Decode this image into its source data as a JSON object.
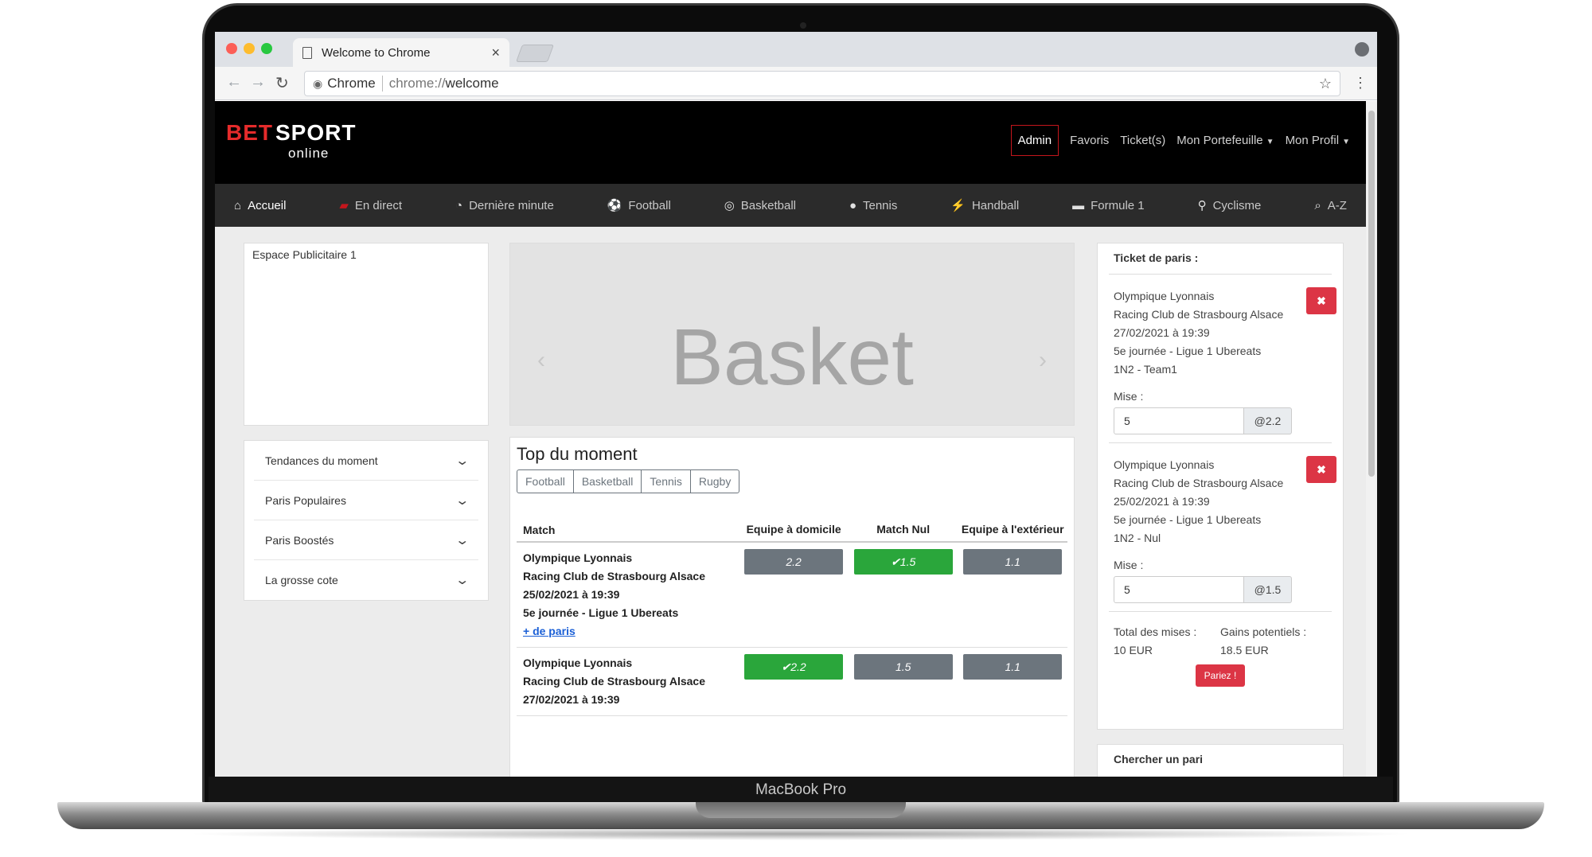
{
  "device": {
    "label": "MacBook Pro"
  },
  "browser": {
    "tab_title": "Welcome to Chrome",
    "close_glyph": "×",
    "omnibox": {
      "site_label": "Chrome",
      "url_scheme": "chrome://",
      "url_host": "welcome"
    }
  },
  "site": {
    "logo": {
      "bet": "BET",
      "sport": "SPORT",
      "online": "online"
    },
    "topnav": {
      "admin": "Admin",
      "favoris": "Favoris",
      "tickets": "Ticket(s)",
      "portefeuille": "Mon Portefeuille",
      "profil": "Mon Profil"
    },
    "sportnav": [
      {
        "label": "Accueil",
        "icon": "home-icon"
      },
      {
        "label": "En direct",
        "icon": "live-icon"
      },
      {
        "label": "Dernière minute",
        "icon": "stopwatch-icon"
      },
      {
        "label": "Football",
        "icon": "football-icon"
      },
      {
        "label": "Basketball",
        "icon": "basketball-icon"
      },
      {
        "label": "Tennis",
        "icon": "tennis-icon"
      },
      {
        "label": "Handball",
        "icon": "handball-icon"
      },
      {
        "label": "Formule 1",
        "icon": "f1-car-icon"
      },
      {
        "label": "Cyclisme",
        "icon": "bicycle-icon"
      },
      {
        "label": "A-Z",
        "icon": "search-icon"
      }
    ]
  },
  "sidebar": {
    "ad_label": "Espace Publicitaire 1",
    "accordion": [
      {
        "label": "Tendances du moment"
      },
      {
        "label": "Paris Populaires"
      },
      {
        "label": "Paris Boostés"
      },
      {
        "label": "La grosse cote"
      }
    ]
  },
  "carousel": {
    "slide_text": "Basket"
  },
  "top_moment": {
    "title": "Top du moment",
    "filters": [
      "Football",
      "Basketball",
      "Tennis",
      "Rugby"
    ],
    "headers": {
      "match": "Match",
      "home": "Equipe à domicile",
      "draw": "Match Nul",
      "away": "Equipe à l'extérieur"
    },
    "rows": [
      {
        "team1": "Olympique Lyonnais",
        "team2": "Racing Club de Strasbourg Alsace",
        "date": "25/02/2021 à 19:39",
        "league": "5e journée - Ligue 1 Ubereats",
        "more": "+ de paris",
        "odds": [
          "2.2",
          "1.5",
          "1.1"
        ],
        "selected": [
          false,
          true,
          false
        ]
      },
      {
        "team1": "Olympique Lyonnais",
        "team2": "Racing Club de Strasbourg Alsace",
        "date": "27/02/2021 à 19:39",
        "league": "",
        "more": "",
        "odds": [
          "2.2",
          "1.5",
          "1.1"
        ],
        "selected": [
          true,
          false,
          false
        ]
      }
    ]
  },
  "ticket": {
    "title": "Ticket de paris :",
    "mise_label": "Mise :",
    "bets": [
      {
        "team1": "Olympique Lyonnais",
        "team2": "Racing Club de Strasbourg Alsace",
        "date": "27/02/2021 à 19:39",
        "league": "5e journée - Ligue 1 Ubereats",
        "type": "1N2 - Team1",
        "stake": "5",
        "odd": "@2.2"
      },
      {
        "team1": "Olympique Lyonnais",
        "team2": "Racing Club de Strasbourg Alsace",
        "date": "25/02/2021 à 19:39",
        "league": "5e journée - Ligue 1 Ubereats",
        "type": "1N2 - Nul",
        "stake": "5",
        "odd": "@1.5"
      }
    ],
    "total_label": "Total des mises :",
    "total_value": "10 EUR",
    "gains_label": "Gains potentiels :",
    "gains_value": "18.5 EUR",
    "submit": "Pariez !"
  },
  "search_card": {
    "title": "Chercher un pari"
  },
  "colors": {
    "brand_red": "#e52b2b",
    "selected_odd": "#2aa63b",
    "odd_default": "#6c757d",
    "danger": "#dc3545"
  }
}
